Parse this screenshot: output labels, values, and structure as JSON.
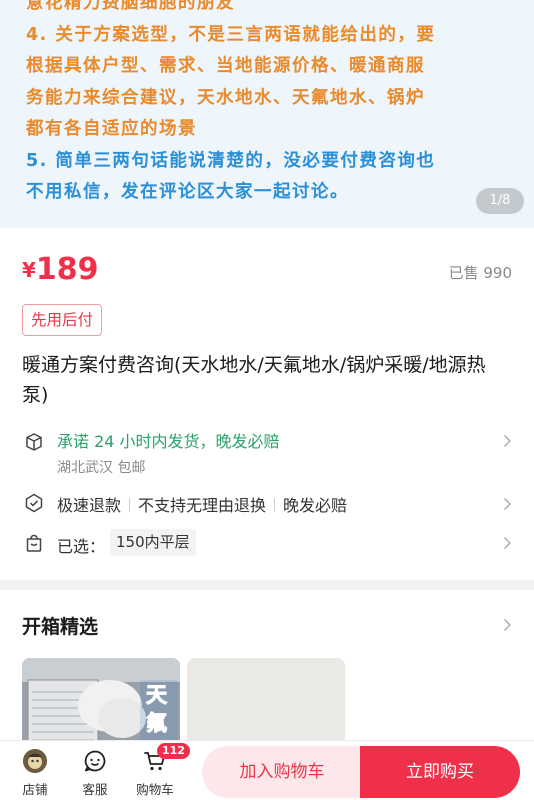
{
  "carousel": {
    "lines": [
      {
        "text": "意花精力费脑细胞的朋友",
        "color": "orange"
      },
      {
        "text": "4. 关于方案选型，不是三言两语就能给出的，要",
        "color": "orange"
      },
      {
        "text": "根据具体户型、需求、当地能源价格、暖通商服",
        "color": "orange"
      },
      {
        "text": "务能力来综合建议，天水地水、天氟地水、锅炉",
        "color": "orange"
      },
      {
        "text": "都有各自适应的场景",
        "color": "orange"
      },
      {
        "text": "5. 简单三两句话能说清楚的，没必要付费咨询也",
        "color": "blue"
      },
      {
        "text": "不用私信，发在评论区大家一起讨论。",
        "color": "blue"
      }
    ],
    "indicator": "1/8"
  },
  "product": {
    "price_symbol": "¥",
    "price": "189",
    "sold": "已售 990",
    "tag": "先用后付",
    "title": "暖通方案付费咨询(天水地水/天氟地水/锅炉采暖/地源热泵)"
  },
  "shipping": {
    "promise": "承诺 24 小时内发货，晚发必赔",
    "location": "湖北武汉 包邮"
  },
  "services": [
    "极速退款",
    "不支持无理由退换",
    "晚发必赔"
  ],
  "selection": {
    "label": "已选：",
    "value": "150内平层"
  },
  "unboxing": {
    "title": "开箱精选",
    "thumb_text": "天氟"
  },
  "bottom": {
    "store": "店铺",
    "service": "客服",
    "cart": "购物车",
    "cart_badge": "112",
    "add_to_cart": "加入购物车",
    "buy_now": "立即购买"
  },
  "colors": {
    "price": "#f0304a",
    "shipping_green": "#2aa36b",
    "orange_text": "#ea8a2b",
    "blue_text": "#2b8fd6"
  },
  "icons": [
    "ship-box-icon",
    "shield-check-icon",
    "bag-icon",
    "chevron-right-icon",
    "store-avatar-icon",
    "chat-smile-icon",
    "cart-icon"
  ]
}
